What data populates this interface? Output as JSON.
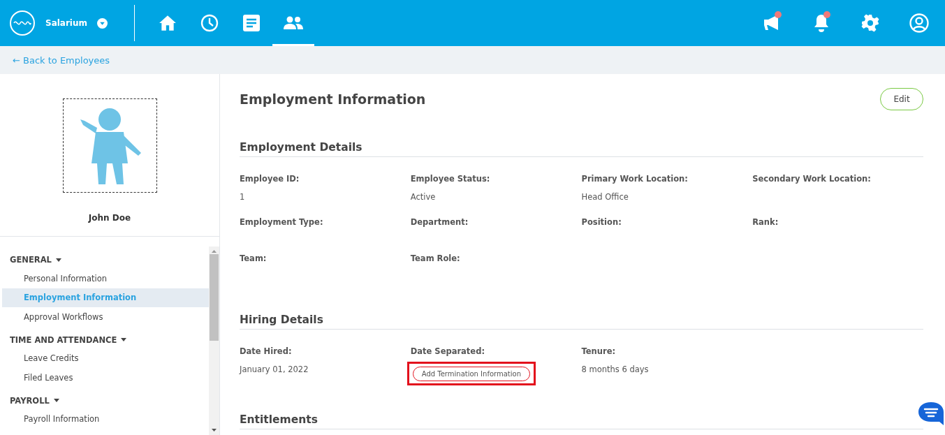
{
  "topbar": {
    "company": "Salarium",
    "nav": [
      {
        "selected": false
      },
      {
        "selected": false
      },
      {
        "selected": false
      },
      {
        "selected": true
      }
    ],
    "actions": [
      {
        "badge": true
      },
      {
        "badge": true
      },
      {
        "badge": false
      },
      {
        "badge": false
      }
    ]
  },
  "breadcrumb": {
    "arrow": "←",
    "label": "Back to Employees"
  },
  "profile": {
    "name": "John Doe"
  },
  "sidebar": {
    "groups": [
      {
        "label": "GENERAL",
        "expanded": true,
        "items": [
          {
            "label": "Personal Information",
            "selected": false
          },
          {
            "label": "Employment Information",
            "selected": true
          },
          {
            "label": "Approval Workflows",
            "selected": false
          }
        ]
      },
      {
        "label": "TIME AND ATTENDANCE",
        "expanded": true,
        "items": [
          {
            "label": "Leave Credits",
            "selected": false
          },
          {
            "label": "Filed Leaves",
            "selected": false
          }
        ]
      },
      {
        "label": "PAYROLL",
        "expanded": true,
        "items": [
          {
            "label": "Payroll Information",
            "selected": false
          }
        ]
      }
    ]
  },
  "main": {
    "title": "Employment Information",
    "edit_button": "Edit",
    "sections": [
      {
        "title": "Employment Details",
        "fields": [
          {
            "label": "Employee ID:",
            "value": "1"
          },
          {
            "label": "Employee Status:",
            "value": "Active"
          },
          {
            "label": "Primary Work Location:",
            "value": "Head Office"
          },
          {
            "label": "Secondary Work Location:"
          },
          {
            "label": "Employment Type:"
          },
          {
            "label": "Department:"
          },
          {
            "label": "Position:"
          },
          {
            "label": "Rank:"
          },
          {
            "label": "Team:"
          },
          {
            "label": "Team Role:"
          }
        ]
      },
      {
        "title": "Hiring Details",
        "fields": [
          {
            "label": "Date Hired:",
            "value": "January 01, 2022"
          },
          {
            "label": "Date Separated:",
            "button": "Add Termination Information",
            "highlighted": true
          },
          {
            "label": "Tenure:",
            "value": "8 months 6 days"
          }
        ]
      },
      {
        "title": "Entitlements"
      }
    ]
  }
}
